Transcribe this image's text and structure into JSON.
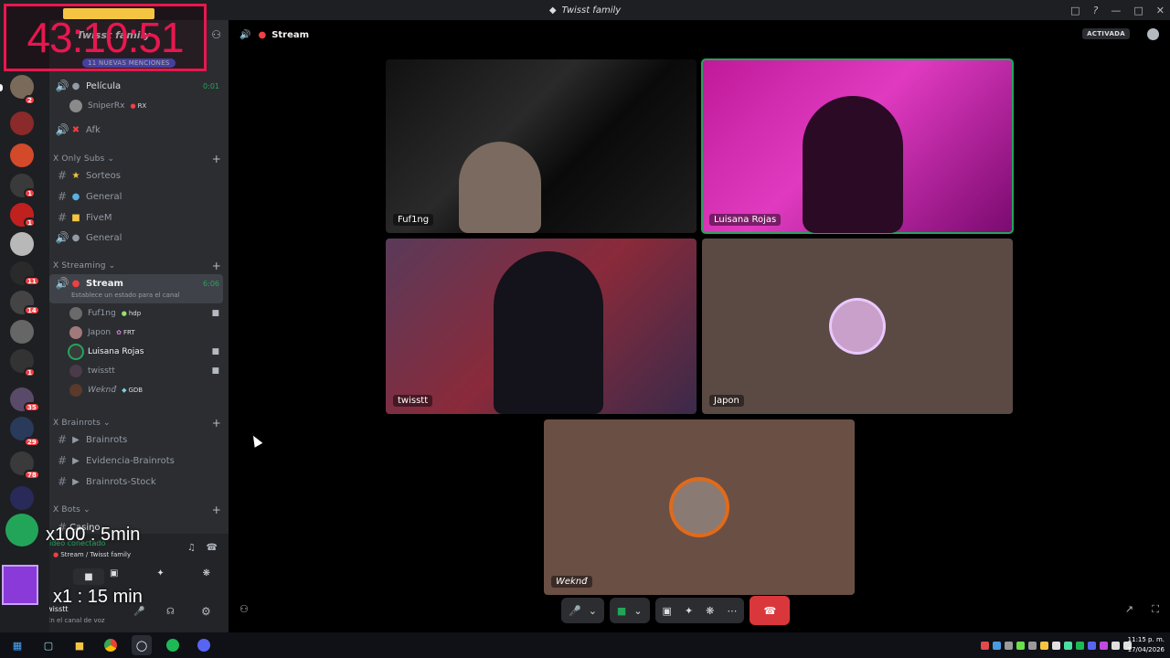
{
  "window": {
    "title": "Twisst family"
  },
  "overlay": {
    "timer": "43:10:51",
    "x100": "x100 : 5min",
    "x1": "x1 : 15 min"
  },
  "rail": {
    "badges": [
      "2",
      "1",
      "1",
      "1",
      "11",
      "14",
      "1",
      "35",
      "29",
      "78"
    ]
  },
  "sidebar": {
    "server_name": "Twisst family",
    "mentions": "11 NUEVAS MENCIONES",
    "pelicula": {
      "label": "Película",
      "time": "0:01"
    },
    "sniper": {
      "name": "SniperRx",
      "tag": "RX"
    },
    "afk": "Afk",
    "cat_only_subs": "Only Subs",
    "sorteos": "Sorteos",
    "general": "General",
    "fivem": "FiveM",
    "general_voice": "General",
    "cat_streaming": "Streaming",
    "stream": {
      "label": "Stream",
      "time": "6:06",
      "status": "Establece un estado para el canal"
    },
    "users": [
      {
        "name": "Fuf1ng",
        "tag": "hdp"
      },
      {
        "name": "Japon",
        "tag": "FRT"
      },
      {
        "name": "Luisana Rojas",
        "tag": ""
      },
      {
        "name": "twisstt",
        "tag": ""
      },
      {
        "name": "Weknđ",
        "tag": "GDB"
      }
    ],
    "cat_brainrots": "Brainrots",
    "brainrots": "Brainrots",
    "evidencia": "Evidencia-Brainrots",
    "stock": "Brainrots-Stock",
    "cat_bots": "Bots",
    "casino": "Casino",
    "voice_connected": "ideo conectado",
    "voice_channel": "Stream / Twisst family",
    "user_name": "twisstt",
    "user_status": "En el canal de voz"
  },
  "stage": {
    "channel": "Stream",
    "active_badge": "ACTIVADA",
    "tiles": {
      "fuf1ng": "Fuf1ng",
      "luisana": "Luisana Rojas",
      "twisstt": "twisstt",
      "japon": "Japon",
      "wekend": "Weknđ"
    }
  },
  "taskbar": {
    "time": "11:15 p. m.",
    "date": "17/04/2026"
  }
}
